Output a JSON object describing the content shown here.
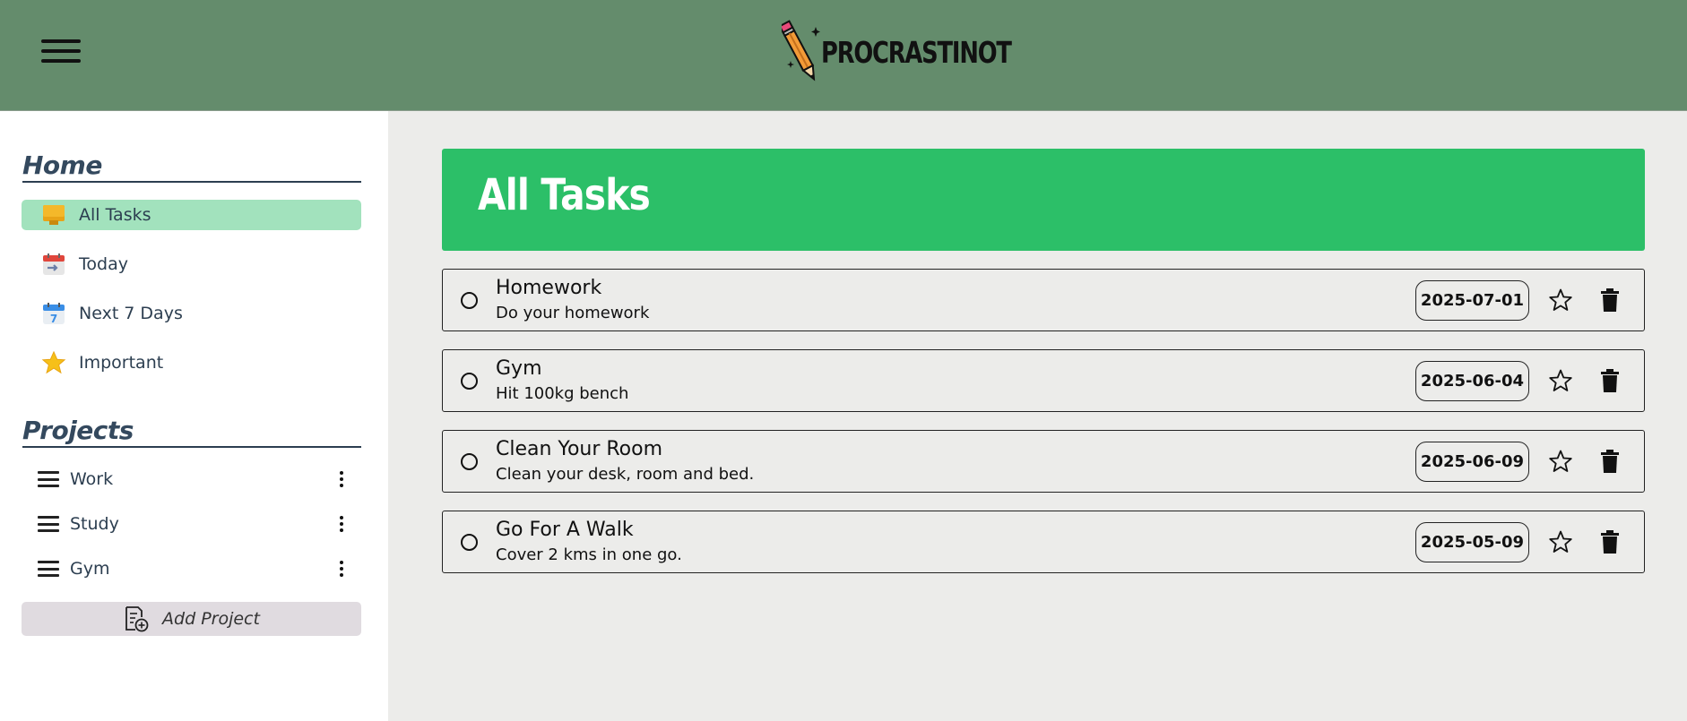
{
  "header": {
    "menu_icon": "hamburger-menu-icon",
    "logo_text": "PROCRASTINOT"
  },
  "sidebar": {
    "home_title": "Home",
    "nav_items": [
      {
        "label": "All Tasks",
        "icon": "inbox-tray-icon",
        "active": true
      },
      {
        "label": "Today",
        "icon": "calendar-today-icon",
        "active": false
      },
      {
        "label": "Next 7 Days",
        "icon": "calendar-seven-icon",
        "active": false
      },
      {
        "label": "Important",
        "icon": "star-icon",
        "active": false
      }
    ],
    "projects_title": "Projects",
    "projects": [
      {
        "label": "Work"
      },
      {
        "label": "Study"
      },
      {
        "label": "Gym"
      }
    ],
    "add_project_label": "Add Project"
  },
  "main": {
    "title": "All Tasks",
    "tasks": [
      {
        "title": "Homework",
        "description": "Do your homework",
        "date": "2025-07-01"
      },
      {
        "title": "Gym",
        "description": "Hit 100kg bench",
        "date": "2025-06-04"
      },
      {
        "title": "Clean Your Room",
        "description": "Clean your desk, room and bed.",
        "date": "2025-06-09"
      },
      {
        "title": "Go For A Walk",
        "description": "Cover 2 kms in one go.",
        "date": "2025-05-09"
      }
    ]
  },
  "colors": {
    "header_bg": "#648c6c",
    "banner_bg": "#2cbf68",
    "active_nav_bg": "#a2e2bd",
    "main_bg": "#ececea",
    "add_project_bg": "#e0dbe0"
  }
}
